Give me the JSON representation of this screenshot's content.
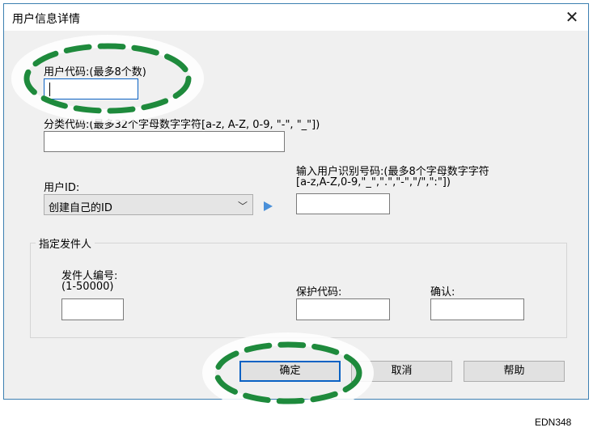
{
  "window": {
    "title": "用户信息详情",
    "close_glyph": "✕"
  },
  "user_code": {
    "label": "用户代码:(最多8个数)",
    "value": ""
  },
  "class_code": {
    "label": "分类代码:(最多32个字母数字字符[a-z, A-Z, 0-9, \"-\", \"_\"])",
    "value": ""
  },
  "user_id": {
    "label": "用户ID:",
    "selected": "创建自己的ID",
    "input_label_line1": "输入用户识别号码:(最多8个字母数字字符",
    "input_label_line2": "[a-z,A-Z,0-9,\"_\",\".\",\"-\",\"/\",\":\"])",
    "value": ""
  },
  "sender_group": {
    "title": "指定发件人",
    "sender_number_label": "发件人编号:",
    "sender_number_range": "(1-50000)",
    "protect_code_label": "保护代码:",
    "confirm_label": "确认:"
  },
  "buttons": {
    "ok": "确定",
    "cancel": "取消",
    "help": "帮助"
  },
  "footer_code": "EDN348",
  "colors": {
    "highlight": "#1e8a3c",
    "focus": "#0a62c4",
    "arrow": "#4a90d9"
  }
}
